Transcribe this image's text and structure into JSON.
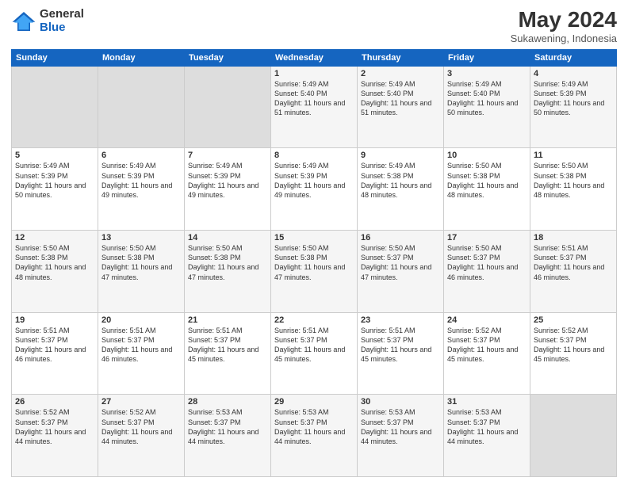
{
  "header": {
    "logo_general": "General",
    "logo_blue": "Blue",
    "title": "May 2024",
    "subtitle": "Sukawening, Indonesia"
  },
  "calendar": {
    "days_of_week": [
      "Sunday",
      "Monday",
      "Tuesday",
      "Wednesday",
      "Thursday",
      "Friday",
      "Saturday"
    ],
    "weeks": [
      [
        {
          "day": "",
          "empty": true
        },
        {
          "day": "",
          "empty": true
        },
        {
          "day": "",
          "empty": true
        },
        {
          "day": "1",
          "sunrise": "5:49 AM",
          "sunset": "5:40 PM",
          "daylight": "11 hours and 51 minutes."
        },
        {
          "day": "2",
          "sunrise": "5:49 AM",
          "sunset": "5:40 PM",
          "daylight": "11 hours and 51 minutes."
        },
        {
          "day": "3",
          "sunrise": "5:49 AM",
          "sunset": "5:40 PM",
          "daylight": "11 hours and 50 minutes."
        },
        {
          "day": "4",
          "sunrise": "5:49 AM",
          "sunset": "5:39 PM",
          "daylight": "11 hours and 50 minutes."
        }
      ],
      [
        {
          "day": "5",
          "sunrise": "5:49 AM",
          "sunset": "5:39 PM",
          "daylight": "11 hours and 50 minutes."
        },
        {
          "day": "6",
          "sunrise": "5:49 AM",
          "sunset": "5:39 PM",
          "daylight": "11 hours and 49 minutes."
        },
        {
          "day": "7",
          "sunrise": "5:49 AM",
          "sunset": "5:39 PM",
          "daylight": "11 hours and 49 minutes."
        },
        {
          "day": "8",
          "sunrise": "5:49 AM",
          "sunset": "5:39 PM",
          "daylight": "11 hours and 49 minutes."
        },
        {
          "day": "9",
          "sunrise": "5:49 AM",
          "sunset": "5:38 PM",
          "daylight": "11 hours and 48 minutes."
        },
        {
          "day": "10",
          "sunrise": "5:50 AM",
          "sunset": "5:38 PM",
          "daylight": "11 hours and 48 minutes."
        },
        {
          "day": "11",
          "sunrise": "5:50 AM",
          "sunset": "5:38 PM",
          "daylight": "11 hours and 48 minutes."
        }
      ],
      [
        {
          "day": "12",
          "sunrise": "5:50 AM",
          "sunset": "5:38 PM",
          "daylight": "11 hours and 48 minutes."
        },
        {
          "day": "13",
          "sunrise": "5:50 AM",
          "sunset": "5:38 PM",
          "daylight": "11 hours and 47 minutes."
        },
        {
          "day": "14",
          "sunrise": "5:50 AM",
          "sunset": "5:38 PM",
          "daylight": "11 hours and 47 minutes."
        },
        {
          "day": "15",
          "sunrise": "5:50 AM",
          "sunset": "5:38 PM",
          "daylight": "11 hours and 47 minutes."
        },
        {
          "day": "16",
          "sunrise": "5:50 AM",
          "sunset": "5:37 PM",
          "daylight": "11 hours and 47 minutes."
        },
        {
          "day": "17",
          "sunrise": "5:50 AM",
          "sunset": "5:37 PM",
          "daylight": "11 hours and 46 minutes."
        },
        {
          "day": "18",
          "sunrise": "5:51 AM",
          "sunset": "5:37 PM",
          "daylight": "11 hours and 46 minutes."
        }
      ],
      [
        {
          "day": "19",
          "sunrise": "5:51 AM",
          "sunset": "5:37 PM",
          "daylight": "11 hours and 46 minutes."
        },
        {
          "day": "20",
          "sunrise": "5:51 AM",
          "sunset": "5:37 PM",
          "daylight": "11 hours and 46 minutes."
        },
        {
          "day": "21",
          "sunrise": "5:51 AM",
          "sunset": "5:37 PM",
          "daylight": "11 hours and 45 minutes."
        },
        {
          "day": "22",
          "sunrise": "5:51 AM",
          "sunset": "5:37 PM",
          "daylight": "11 hours and 45 minutes."
        },
        {
          "day": "23",
          "sunrise": "5:51 AM",
          "sunset": "5:37 PM",
          "daylight": "11 hours and 45 minutes."
        },
        {
          "day": "24",
          "sunrise": "5:52 AM",
          "sunset": "5:37 PM",
          "daylight": "11 hours and 45 minutes."
        },
        {
          "day": "25",
          "sunrise": "5:52 AM",
          "sunset": "5:37 PM",
          "daylight": "11 hours and 45 minutes."
        }
      ],
      [
        {
          "day": "26",
          "sunrise": "5:52 AM",
          "sunset": "5:37 PM",
          "daylight": "11 hours and 44 minutes."
        },
        {
          "day": "27",
          "sunrise": "5:52 AM",
          "sunset": "5:37 PM",
          "daylight": "11 hours and 44 minutes."
        },
        {
          "day": "28",
          "sunrise": "5:53 AM",
          "sunset": "5:37 PM",
          "daylight": "11 hours and 44 minutes."
        },
        {
          "day": "29",
          "sunrise": "5:53 AM",
          "sunset": "5:37 PM",
          "daylight": "11 hours and 44 minutes."
        },
        {
          "day": "30",
          "sunrise": "5:53 AM",
          "sunset": "5:37 PM",
          "daylight": "11 hours and 44 minutes."
        },
        {
          "day": "31",
          "sunrise": "5:53 AM",
          "sunset": "5:37 PM",
          "daylight": "11 hours and 44 minutes."
        },
        {
          "day": "",
          "empty": true
        }
      ]
    ]
  }
}
